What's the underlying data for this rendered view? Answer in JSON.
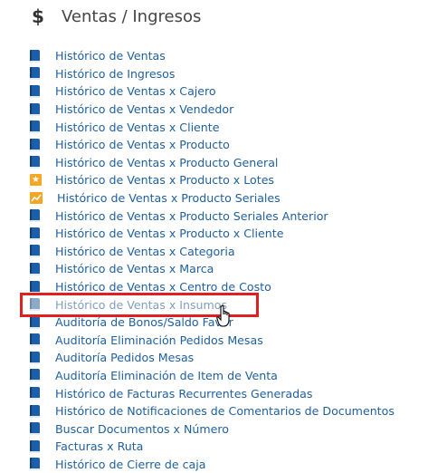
{
  "header": {
    "icon": "dollar-icon",
    "title": "Ventas / Ingresos"
  },
  "colors": {
    "link": "#1f5f9d",
    "book_icon": "#1c5fa8",
    "highlight": "#e02020",
    "accent_icon": "#f5a623"
  },
  "items": [
    {
      "label": "Histórico de Ventas",
      "icon": "book-icon"
    },
    {
      "label": "Histórico de Ingresos",
      "icon": "book-icon"
    },
    {
      "label": "Histórico de Ventas x Cajero",
      "icon": "book-icon"
    },
    {
      "label": "Histórico de Ventas x Vendedor",
      "icon": "book-icon"
    },
    {
      "label": "Histórico de Ventas x Cliente",
      "icon": "book-icon"
    },
    {
      "label": "Histórico de Ventas x Producto",
      "icon": "book-icon"
    },
    {
      "label": "Histórico de Ventas x Producto General",
      "icon": "book-icon"
    },
    {
      "label": "Histórico de Ventas x Producto x Lotes",
      "icon": "star-icon"
    },
    {
      "label": "Histórico de Ventas x Producto Seriales",
      "icon": "chart-icon"
    },
    {
      "label": "Histórico de Ventas x Producto Seriales Anterior",
      "icon": "book-icon"
    },
    {
      "label": "Histórico de Ventas x Producto x Cliente",
      "icon": "book-icon"
    },
    {
      "label": "Histórico de Ventas x Categoria",
      "icon": "book-icon"
    },
    {
      "label": "Histórico de Ventas x Marca",
      "icon": "book-icon"
    },
    {
      "label": "Histórico de Ventas x Centro de Costo",
      "icon": "book-icon"
    },
    {
      "label": "Histórico de Ventas x Insumos",
      "icon": "book-icon"
    },
    {
      "label": "Auditoría de Bonos/Saldo Favor",
      "icon": "book-icon"
    },
    {
      "label": "Auditoría Eliminación Pedidos Mesas",
      "icon": "book-icon"
    },
    {
      "label": "Auditoría Pedidos Mesas",
      "icon": "book-icon"
    },
    {
      "label": "Auditoría Eliminación de Item de Venta",
      "icon": "book-icon"
    },
    {
      "label": "Histórico de Facturas Recurrentes Generadas",
      "icon": "book-icon"
    },
    {
      "label": "Histórico de Notificaciones de Comentarios de Documentos",
      "icon": "book-icon"
    },
    {
      "label": "Buscar Documentos x Número",
      "icon": "book-icon"
    },
    {
      "label": "Facturas x Ruta",
      "icon": "book-icon"
    },
    {
      "label": "Histórico de Cierre de caja",
      "icon": "book-icon"
    }
  ]
}
